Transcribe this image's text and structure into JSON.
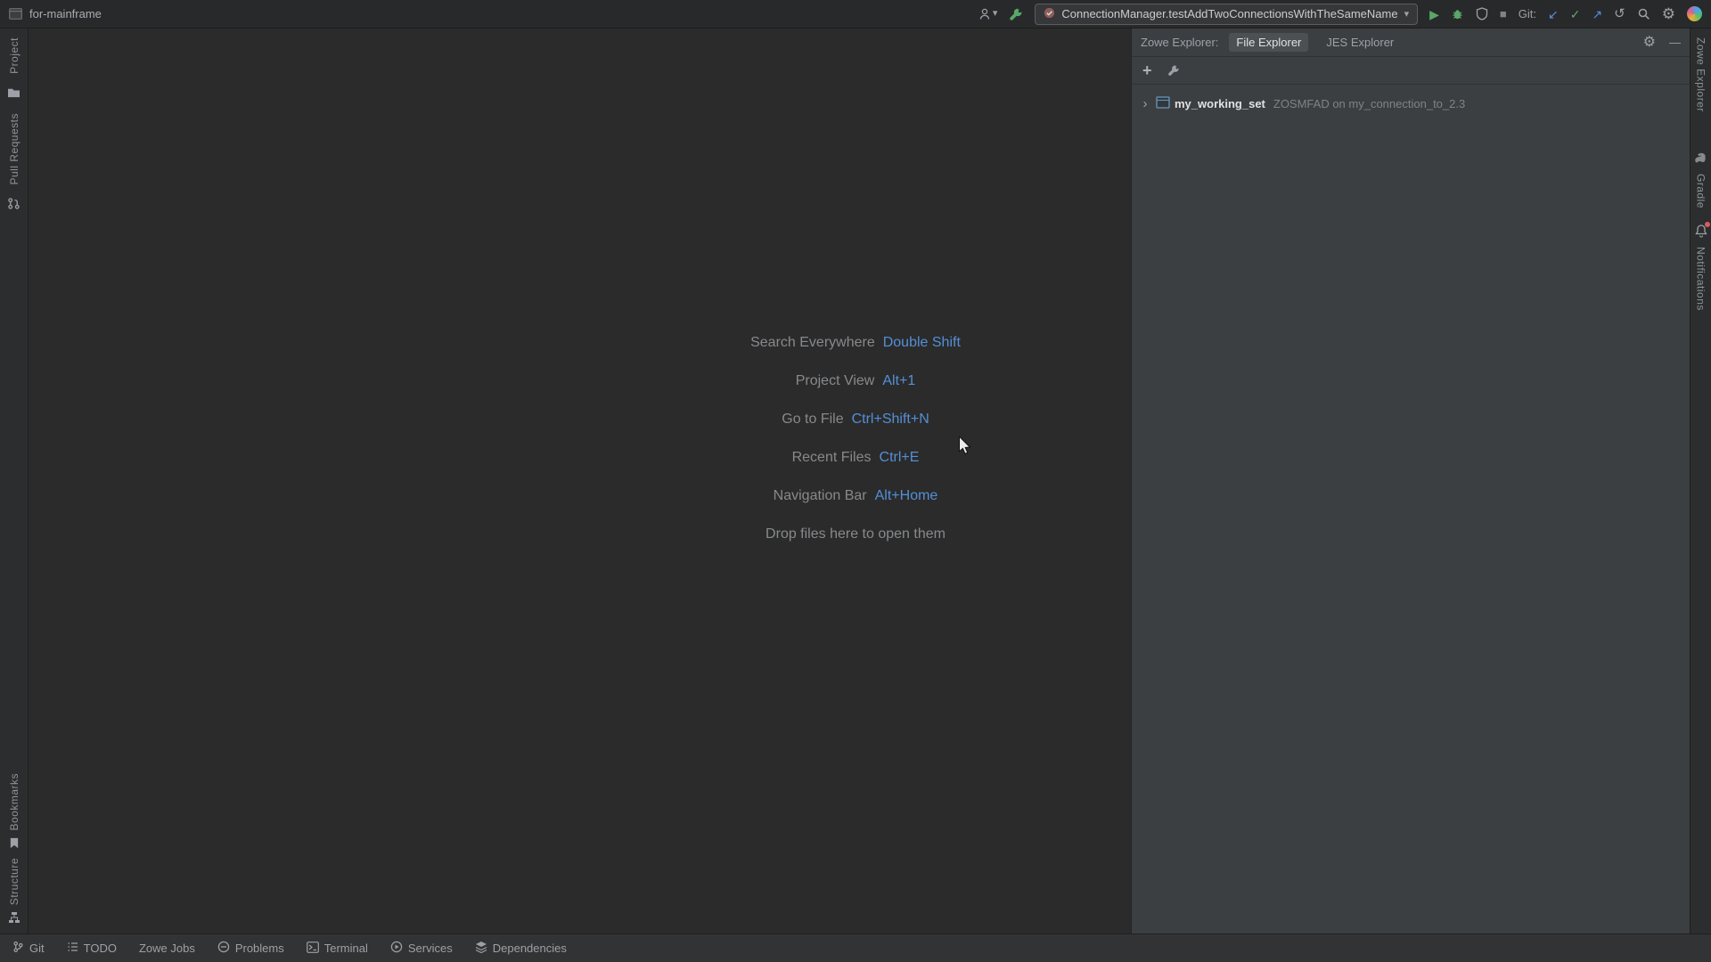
{
  "colors": {
    "accent_blue": "#548fd6",
    "run_green": "#59a869",
    "editor_bg": "#2b2b2b",
    "panel_bg": "#3c3f41",
    "titlebar_bg": "#28292b",
    "statusbar_bg": "#313335"
  },
  "titlebar": {
    "window_title": "for-mainframe",
    "run_config": "ConnectionManager.testAddTwoConnectionsWithTheSameName",
    "git_label": "Git:"
  },
  "left_stripe": {
    "project_label": "Project",
    "pull_requests_label": "Pull Requests",
    "bookmarks_label": "Bookmarks",
    "structure_label": "Structure"
  },
  "right_stripe": {
    "zowe_label": "Zowe Explorer",
    "gradle_label": "Gradle",
    "notifications_label": "Notifications"
  },
  "editor": {
    "hints": [
      {
        "label": "Search Everywhere",
        "shortcut": "Double Shift"
      },
      {
        "label": "Project View",
        "shortcut": "Alt+1"
      },
      {
        "label": "Go to File",
        "shortcut": "Ctrl+Shift+N"
      },
      {
        "label": "Recent Files",
        "shortcut": "Ctrl+E"
      },
      {
        "label": "Navigation Bar",
        "shortcut": "Alt+Home"
      }
    ],
    "drop_hint": "Drop files here to open them"
  },
  "panel": {
    "title": "Zowe Explorer:",
    "tabs": [
      {
        "label": "File Explorer",
        "selected": true
      },
      {
        "label": "JES Explorer",
        "selected": false
      }
    ],
    "tree": [
      {
        "name": "my_working_set",
        "detail": "ZOSMFAD on my_connection_to_2.3"
      }
    ]
  },
  "statusbar": {
    "items": [
      "Git",
      "TODO",
      "Zowe Jobs",
      "Problems",
      "Terminal",
      "Services",
      "Dependencies"
    ]
  },
  "icons": {
    "dropdown": "▾",
    "play": "▶",
    "stop": "■",
    "gear": "⚙",
    "minimize": "—",
    "plus": "+",
    "chevron_right": "›",
    "commit_check": "✓",
    "push_arrow": "↗",
    "update_arrow": "↙",
    "rollback": "↺"
  }
}
